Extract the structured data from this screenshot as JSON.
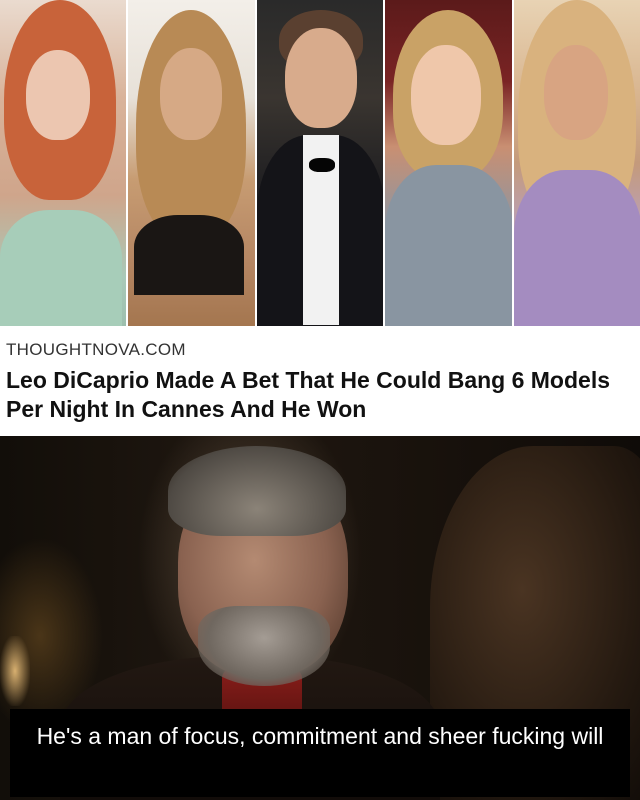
{
  "article": {
    "source": "THOUGHTNOVA.COM",
    "headline": "Leo DiCaprio Made A Bet That He Could Bang 6 Models Per Night In Cannes And He Won"
  },
  "caption": {
    "text": "He's a man of focus, commitment and sheer fucking will"
  }
}
